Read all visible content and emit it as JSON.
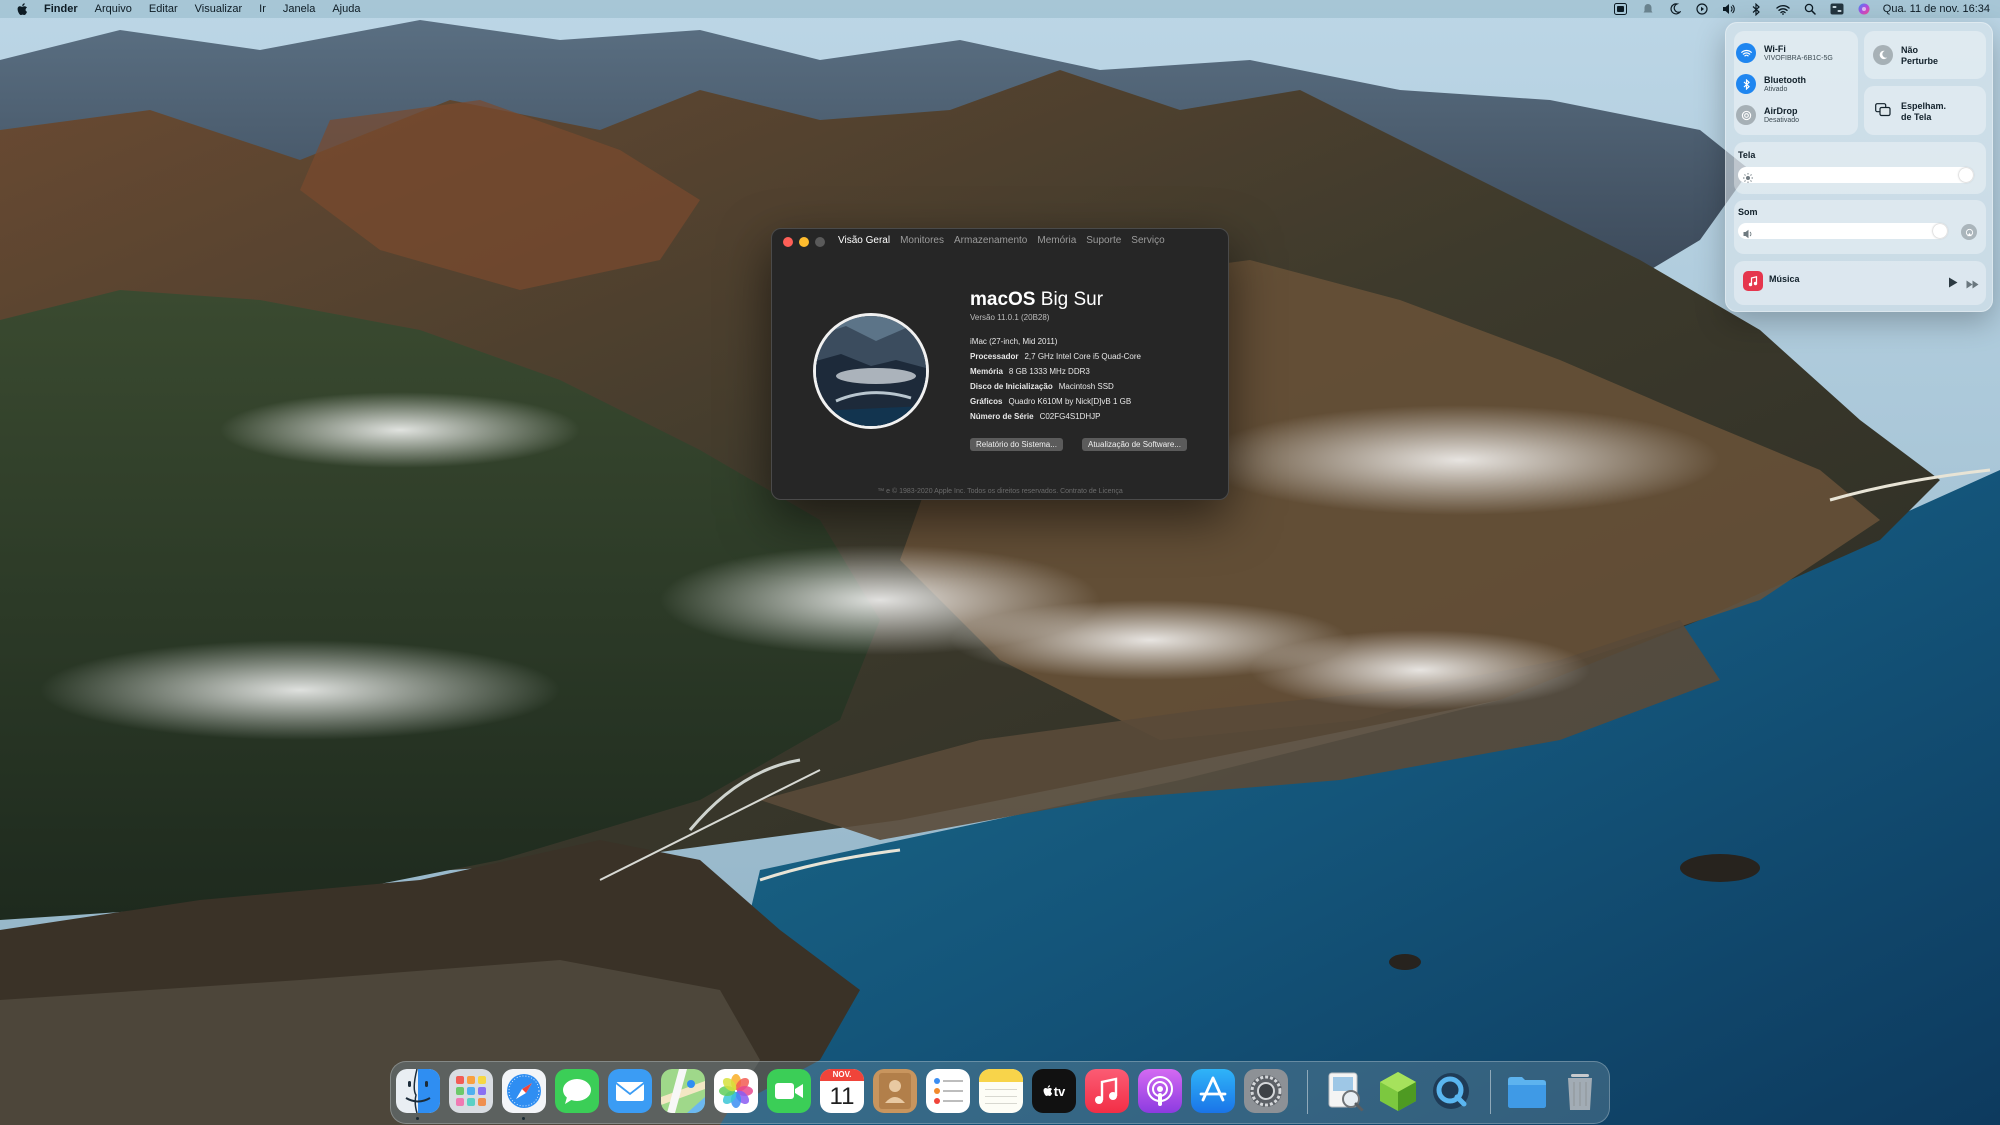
{
  "menubar": {
    "apple_icon": "apple-logo-icon",
    "app_name": "Finder",
    "menus": [
      "Arquivo",
      "Editar",
      "Visualizar",
      "Ir",
      "Janela",
      "Ajuda"
    ],
    "status_icons": [
      "siri-keyboard-icon",
      "notification-icon",
      "moon-icon",
      "play-circle-icon",
      "volume-icon",
      "bluetooth-icon",
      "wifi-icon",
      "search-icon",
      "control-center-icon",
      "siri-icon"
    ],
    "clock": "Qua. 11 de nov.  16:34"
  },
  "about_window": {
    "tabs": [
      "Visão Geral",
      "Monitores",
      "Armazenamento",
      "Memória",
      "Suporte",
      "Serviço"
    ],
    "active_tab": "Visão Geral",
    "os_name": "macOS",
    "os_version_name": "Big Sur",
    "version": "Versão 11.0.1 (20B28)",
    "model": "iMac (27-inch, Mid 2011)",
    "specs": [
      {
        "key": "Processador",
        "value": "2,7 GHz Intel Core i5 Quad-Core"
      },
      {
        "key": "Memória",
        "value": "8 GB 1333 MHz DDR3"
      },
      {
        "key": "Disco de Inicialização",
        "value": "Macintosh SSD"
      },
      {
        "key": "Gráficos",
        "value": "Quadro K610M by Nick[D]vB 1 GB"
      },
      {
        "key": "Número de Série",
        "value": "C02FG4S1DHJP"
      }
    ],
    "buttons": {
      "system_report": "Relatório do Sistema...",
      "software_update": "Atualização de Software..."
    },
    "copyright": "™ e © 1983-2020 Apple Inc. Todos os direitos reservados. Contrato de Licença"
  },
  "control_center": {
    "wifi": {
      "title": "Wi-Fi",
      "subtitle": "VIVOFIBRA-6B1C-5G",
      "icon": "wifi-icon",
      "on": true
    },
    "bluetooth": {
      "title": "Bluetooth",
      "subtitle": "Ativado",
      "icon": "bluetooth-icon",
      "on": true
    },
    "airdrop": {
      "title": "AirDrop",
      "subtitle": "Desativado",
      "icon": "airdrop-icon",
      "on": false
    },
    "do_not_disturb": {
      "title": "Não",
      "title2": "Perturbe",
      "icon": "moon-icon"
    },
    "screen_mirroring": {
      "title": "Espelham.",
      "title2": "de Tela",
      "icon": "screen-mirroring-icon"
    },
    "display": {
      "label": "Tela",
      "level": 1.0,
      "icon": "sun-icon"
    },
    "sound": {
      "label": "Som",
      "level": 1.0,
      "icon": "speaker-icon"
    },
    "now_playing": {
      "app": "Música",
      "icon": "music-icon"
    }
  },
  "dock": {
    "apps": [
      {
        "name": "finder-icon",
        "running": true
      },
      {
        "name": "launchpad-icon",
        "running": false
      },
      {
        "name": "safari-icon",
        "running": true
      },
      {
        "name": "messages-icon",
        "running": false
      },
      {
        "name": "mail-icon",
        "running": false
      },
      {
        "name": "maps-icon",
        "running": false
      },
      {
        "name": "photos-icon",
        "running": false
      },
      {
        "name": "facetime-icon",
        "running": false
      },
      {
        "name": "calendar-icon",
        "running": false
      },
      {
        "name": "contacts-icon",
        "running": false
      },
      {
        "name": "reminders-icon",
        "running": false
      },
      {
        "name": "notes-icon",
        "running": false
      },
      {
        "name": "apple-tv-icon",
        "running": false
      },
      {
        "name": "music-icon",
        "running": false
      },
      {
        "name": "podcasts-icon",
        "running": false
      },
      {
        "name": "app-store-icon",
        "running": false
      },
      {
        "name": "system-preferences-icon",
        "running": false
      },
      {
        "name": "preview-icon",
        "running": false
      },
      {
        "name": "cube-app-icon",
        "running": false
      },
      {
        "name": "quicktime-icon",
        "running": false
      },
      {
        "name": "downloads-folder-icon",
        "running": false
      },
      {
        "name": "trash-icon",
        "running": false
      }
    ],
    "calendar": {
      "month": "NOV.",
      "day": "11"
    },
    "tv_label": "tv"
  }
}
